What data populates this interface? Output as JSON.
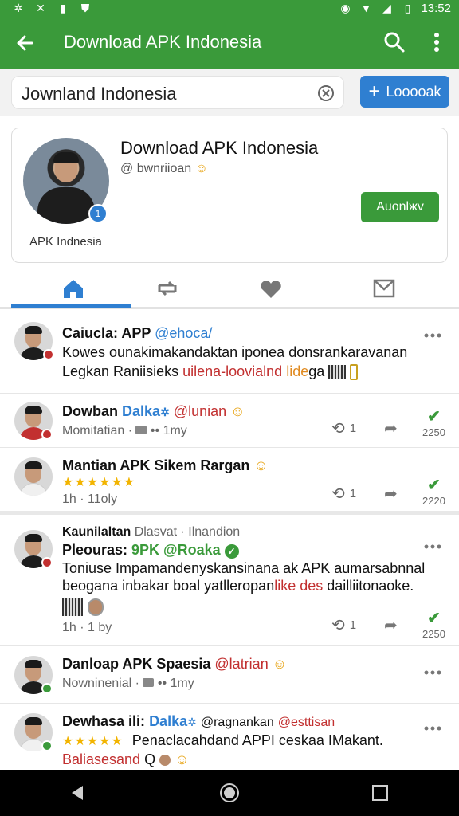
{
  "status_bar": {
    "time": "13:52"
  },
  "app_bar": {
    "title": "Download APK Indonesia"
  },
  "search": {
    "value": "Jownland Indonesia",
    "follow_label": "Looooak"
  },
  "profile": {
    "name": "Download APK Indonesia",
    "handle": "@ bwnriioan",
    "label": "APK Indnesia",
    "follow_label": "Auonlжv",
    "badge": "1"
  },
  "posts": [
    {
      "name": "Caiucla: APP",
      "handle": "@ehoca/",
      "line1": "Kowes ounakimakandaktan iponea donsrankaravanan",
      "line2_a": "Legkan Raniisieks ",
      "line2_b": "uilena-loovialnd",
      "line2_c": " ",
      "line2_d": "lide",
      "line2_e": "ga"
    },
    {
      "name": "Dowban",
      "tag": "Dalka",
      "mention": "@lunian",
      "meta": "Momitatian · ",
      "meta2": " •• 1my",
      "repost_count": "1",
      "like_count": "2250"
    },
    {
      "name": "Mantian APK Sikem Rargan",
      "stars": "★★★★★★",
      "meta": "1h · 11oly",
      "repost_count": "1",
      "like_count": "2220"
    },
    {
      "name": "Kaunilaltan",
      "sub": "Dlasvat · Ilnandion",
      "line0_a": "Pleouras: ",
      "line0_b": "9PK @Roaka",
      "line1": "Toniuse Impamandenyskansinana ak APK aumarsabnnal",
      "line2_a": "beogana inbakar boal yatlleropan",
      "line2_b": "like des",
      "line2_c": " dailliitonaoke.",
      "meta": "1h · 1 by",
      "repost_count": "1",
      "like_count": "2250"
    },
    {
      "name": "Danloap APK Spaesia",
      "mention": "@latrian",
      "meta": "Nowninenial · ",
      "meta2": " •• 1my"
    },
    {
      "name": "Dewhasa ili:",
      "tag": "Dalka",
      "mention": "@ragnankan",
      "red_tag": "@esttisan",
      "stars": "★★★★★",
      "line1": "Penaclacahdand APPI ceskaa IMakant.",
      "line2_a": "Baliasesand",
      "line2_b": " Q"
    }
  ],
  "colors": {
    "primary": "#3a9a3a",
    "accent": "#2f7fd1",
    "red": "#c23030",
    "star": "#f2b400"
  }
}
